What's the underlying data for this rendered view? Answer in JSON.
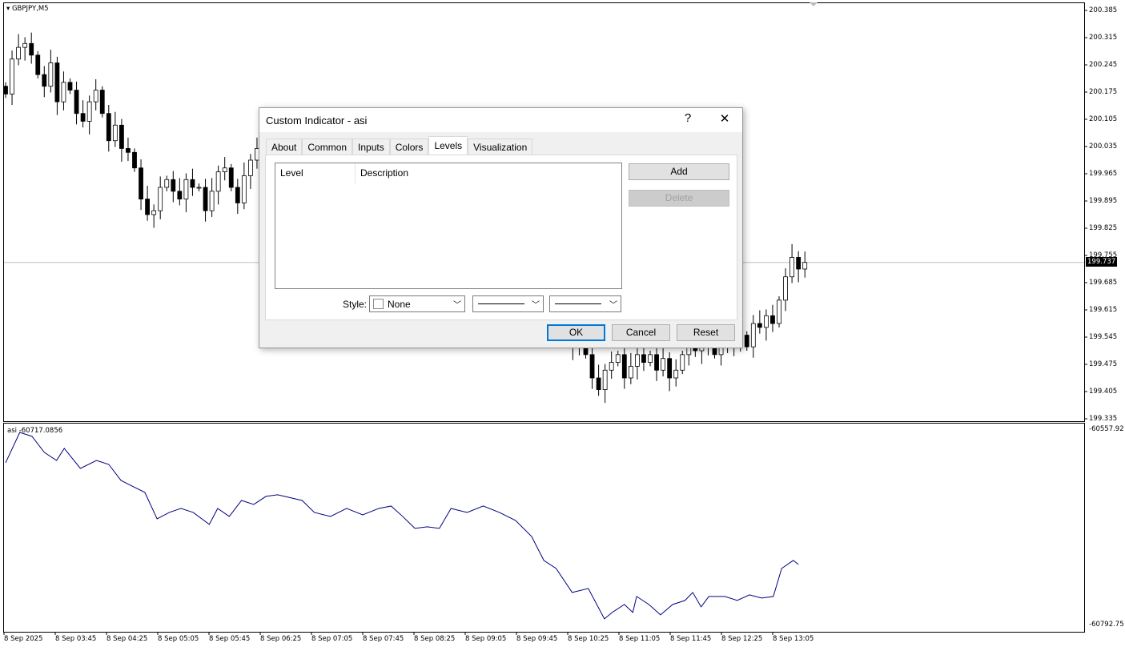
{
  "chart": {
    "symbol": "GBPJPY,M5",
    "current_price": "199.737",
    "price_ticks": [
      "200.385",
      "200.315",
      "200.245",
      "200.175",
      "200.105",
      "200.035",
      "199.965",
      "199.895",
      "199.825",
      "199.755",
      "199.685",
      "199.615",
      "199.545",
      "199.475",
      "199.405",
      "199.335"
    ],
    "time_ticks": [
      "8 Sep 2025",
      "8 Sep 03:45",
      "8 Sep 04:25",
      "8 Sep 05:05",
      "8 Sep 05:45",
      "8 Sep 06:25",
      "8 Sep 07:05",
      "8 Sep 07:45",
      "8 Sep 08:25",
      "8 Sep 09:05",
      "8 Sep 09:45",
      "8 Sep 10:25",
      "8 Sep 11:05",
      "8 Sep 11:45",
      "8 Sep 12:25",
      "8 Sep 13:05"
    ],
    "price_range": [
      199.335,
      200.385
    ],
    "closes": [
      200.17,
      200.26,
      200.29,
      200.3,
      200.27,
      200.22,
      200.19,
      200.25,
      200.15,
      200.2,
      200.18,
      200.12,
      200.1,
      200.15,
      200.18,
      200.12,
      200.05,
      200.09,
      200.03,
      200.02,
      199.98,
      199.9,
      199.86,
      199.87,
      199.93,
      199.95,
      199.92,
      199.9,
      199.95,
      199.93,
      199.93,
      199.87,
      199.92,
      199.97,
      199.98,
      199.93,
      199.89,
      199.96,
      200.0,
      200.03,
      199.99,
      199.98,
      199.95,
      199.97,
      199.93,
      199.9,
      199.92,
      199.89,
      199.91,
      199.88,
      199.86,
      199.88,
      199.85,
      199.87,
      199.84,
      199.86,
      199.88,
      199.85,
      199.83,
      199.8,
      199.82,
      199.84,
      199.81,
      199.79,
      199.82,
      199.85,
      199.83,
      199.81,
      199.84,
      199.82,
      199.8,
      199.78,
      199.75,
      199.72,
      199.74,
      199.7,
      199.68,
      199.66,
      199.64,
      199.65,
      199.62,
      199.6,
      199.58,
      199.6,
      199.57,
      199.55,
      199.58,
      199.56,
      199.52,
      199.53,
      199.5,
      199.44,
      199.41,
      199.46,
      199.48,
      199.5,
      199.44,
      199.47,
      199.5,
      199.48,
      199.5,
      199.46,
      199.49,
      199.44,
      199.46,
      199.5,
      199.52,
      199.51,
      199.53,
      199.52,
      199.5,
      199.52,
      199.55,
      199.53,
      199.55,
      199.52,
      199.58,
      199.57,
      199.6,
      199.58,
      199.64,
      199.7,
      199.75,
      199.72,
      199.737
    ],
    "candle_colors": {
      "bull": "#ffffff",
      "bear": "#000000",
      "outline": "#000000"
    }
  },
  "indicator": {
    "label": "asi -60717.0856",
    "max_label": "-60557.92",
    "min_label": "-60792.75",
    "range": [
      -60792.75,
      -60557.92
    ],
    "line_color": "#000080",
    "points": [
      [
        0,
        -60597.3
      ],
      [
        2.2,
        -60560.8
      ],
      [
        4.1,
        -60565.6
      ],
      [
        6,
        -60584.8
      ],
      [
        7.9,
        -60594.5
      ],
      [
        9.1,
        -60580
      ],
      [
        11.6,
        -60604.1
      ],
      [
        14.1,
        -60594.5
      ],
      [
        16,
        -60599.3
      ],
      [
        17.9,
        -60618.5
      ],
      [
        19.1,
        -60623.3
      ],
      [
        21.6,
        -60632.9
      ],
      [
        23.5,
        -60664.7
      ],
      [
        25.4,
        -60657
      ],
      [
        27.2,
        -60652.2
      ],
      [
        29.1,
        -60657
      ],
      [
        31.6,
        -60671.4
      ],
      [
        32.9,
        -60652.2
      ],
      [
        34.7,
        -60661.8
      ],
      [
        36.6,
        -60642.6
      ],
      [
        38.5,
        -60647.4
      ],
      [
        40.4,
        -60637.7
      ],
      [
        42.2,
        -60635.8
      ],
      [
        46,
        -60642.6
      ],
      [
        47.9,
        -60657
      ],
      [
        50.4,
        -60661.8
      ],
      [
        52.9,
        -60652.2
      ],
      [
        55.4,
        -60659.9
      ],
      [
        57.9,
        -60652.2
      ],
      [
        59.8,
        -60649.3
      ],
      [
        61.6,
        -60661.8
      ],
      [
        63.5,
        -60676.2
      ],
      [
        65.4,
        -60674.3
      ],
      [
        67.3,
        -60676.2
      ],
      [
        69.1,
        -60652.2
      ],
      [
        71.6,
        -60657
      ],
      [
        74.1,
        -60649.3
      ],
      [
        76.6,
        -60657
      ],
      [
        79.1,
        -60666.6
      ],
      [
        81.6,
        -60685.8
      ],
      [
        83.5,
        -60714.7
      ],
      [
        85.4,
        -60724.3
      ],
      [
        87.9,
        -60753.2
      ],
      [
        90.4,
        -60748.4
      ],
      [
        92.9,
        -60784.9
      ],
      [
        94.1,
        -60777.2
      ],
      [
        96,
        -60767.6
      ],
      [
        97.3,
        -60777.2
      ],
      [
        97.9,
        -60758
      ],
      [
        99.8,
        -60767.6
      ],
      [
        101.6,
        -60780.1
      ],
      [
        103.5,
        -60767.6
      ],
      [
        105.4,
        -60762.8
      ],
      [
        106.6,
        -60753.2
      ],
      [
        107.9,
        -60770.5
      ],
      [
        109.1,
        -60758
      ],
      [
        111.6,
        -60758
      ],
      [
        113.5,
        -60762.8
      ],
      [
        115.4,
        -60756.1
      ],
      [
        117.3,
        -60759.9
      ],
      [
        119.1,
        -60758
      ],
      [
        120.4,
        -60724.3
      ],
      [
        122.2,
        -60714.7
      ],
      [
        123,
        -60719.5
      ]
    ]
  },
  "dialog": {
    "title": "Custom Indicator - asi",
    "help": "?",
    "close": "✕",
    "tabs": [
      "About",
      "Common",
      "Inputs",
      "Colors",
      "Levels",
      "Visualization"
    ],
    "active_tab": "Levels",
    "columns": [
      "Level",
      "Description"
    ],
    "add": "Add",
    "delete": "Delete",
    "style_label": "Style:",
    "color_value": "None",
    "ok": "OK",
    "cancel": "Cancel",
    "reset": "Reset"
  }
}
